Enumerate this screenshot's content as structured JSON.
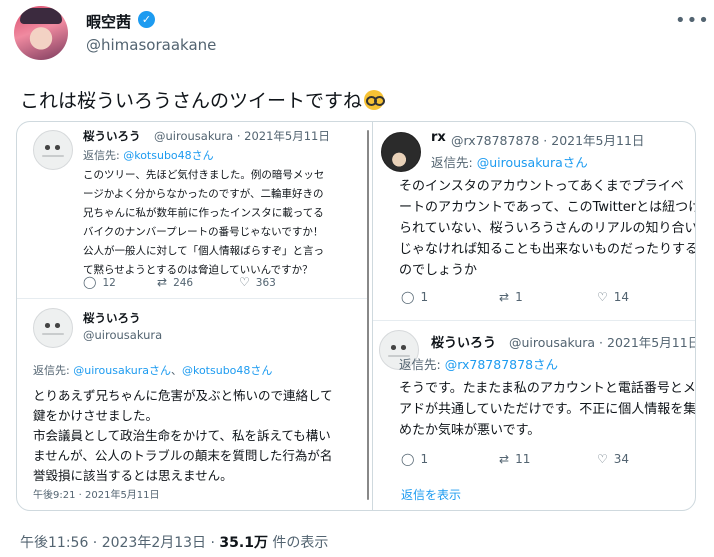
{
  "author": {
    "name": "暇空茜",
    "handle": "@himasoraakane"
  },
  "tweet": {
    "text": "これは桜ういろうさんのツイートですね"
  },
  "media": {
    "left": {
      "tweet1": {
        "name": "桜ういろう",
        "handle_date": "@uirousakura · 2021年5月11日",
        "reply_prefix": "返信先:",
        "reply_to": "@kotsubo48さん",
        "lines": [
          "このツリー、先ほど気付きました。例の暗号メッセ",
          "ージかよく分からなかったのですが、二輪車好きの",
          "兄ちゃんに私が数年前に作ったインスタに載ってる",
          "バイクのナンバープレートの番号じゃないですか！",
          "公人が一般人に対して「個人情報ばらすぞ」と言っ",
          "て黙らせようとするのは脅迫していいんですか？"
        ],
        "replies": "12",
        "retweets": "246",
        "likes": "363"
      },
      "tweet2": {
        "name": "桜ういろう",
        "handle": "@uirousakura",
        "reply_prefix": "返信先:",
        "reply_to_1": "@uirousakuraさん",
        "reply_join": "、",
        "reply_to_2": "@kotsubo48さん",
        "lines": [
          "とりあえず兄ちゃんに危害が及ぶと怖いので連絡して",
          "鍵をかけさせました。",
          "市会議員として政治生命をかけて、私を訴えても構い",
          "ませんが、公人のトラブルの顛末を質問した行為が名",
          "誉毀損に該当するとは思えません。"
        ],
        "timestamp": "午後9:21 · 2021年5月11日"
      }
    },
    "right": {
      "tweet1": {
        "name": "rx",
        "handle_date": "@rx78787878 · 2021年5月11日",
        "reply_prefix": "返信先:",
        "reply_to": "@uirousakuraさん",
        "lines": [
          "そのインスタのアカウントってあくまでプライベ",
          "ートのアカウントであって、このTwitterとは紐つけ",
          "られていない、桜ういろうさんのリアルの知り合い",
          "じゃなければ知ることも出来ないものだったりする",
          "のでしょうか"
        ],
        "replies": "1",
        "retweets": "1",
        "likes": "14"
      },
      "tweet2": {
        "name": "桜ういろう",
        "handle_date": "@uirousakura · 2021年5月11日",
        "reply_prefix": "返信先:",
        "reply_to": "@rx78787878さん",
        "lines": [
          "そうです。たまたま私のアカウントと電話番号とメ",
          "アドが共通していただけです。不正に個人情報を集",
          "めたか気味が悪いです。"
        ],
        "replies": "1",
        "retweets": "11",
        "likes": "34",
        "show_replies": "返信を表示"
      }
    }
  },
  "footer": {
    "time_date": "午後11:56 · 2023年2月13日 · ",
    "views": "35.1万",
    "views_label": " 件の表示"
  },
  "colors": {
    "accent": "#1d9bf0",
    "text": "#0f1419",
    "secondary": "#536471",
    "border": "#cfd9de"
  },
  "icons": [
    "verified-icon",
    "more-icon",
    "reply-icon",
    "retweet-icon",
    "like-icon",
    "nerd-face-emoji"
  ]
}
